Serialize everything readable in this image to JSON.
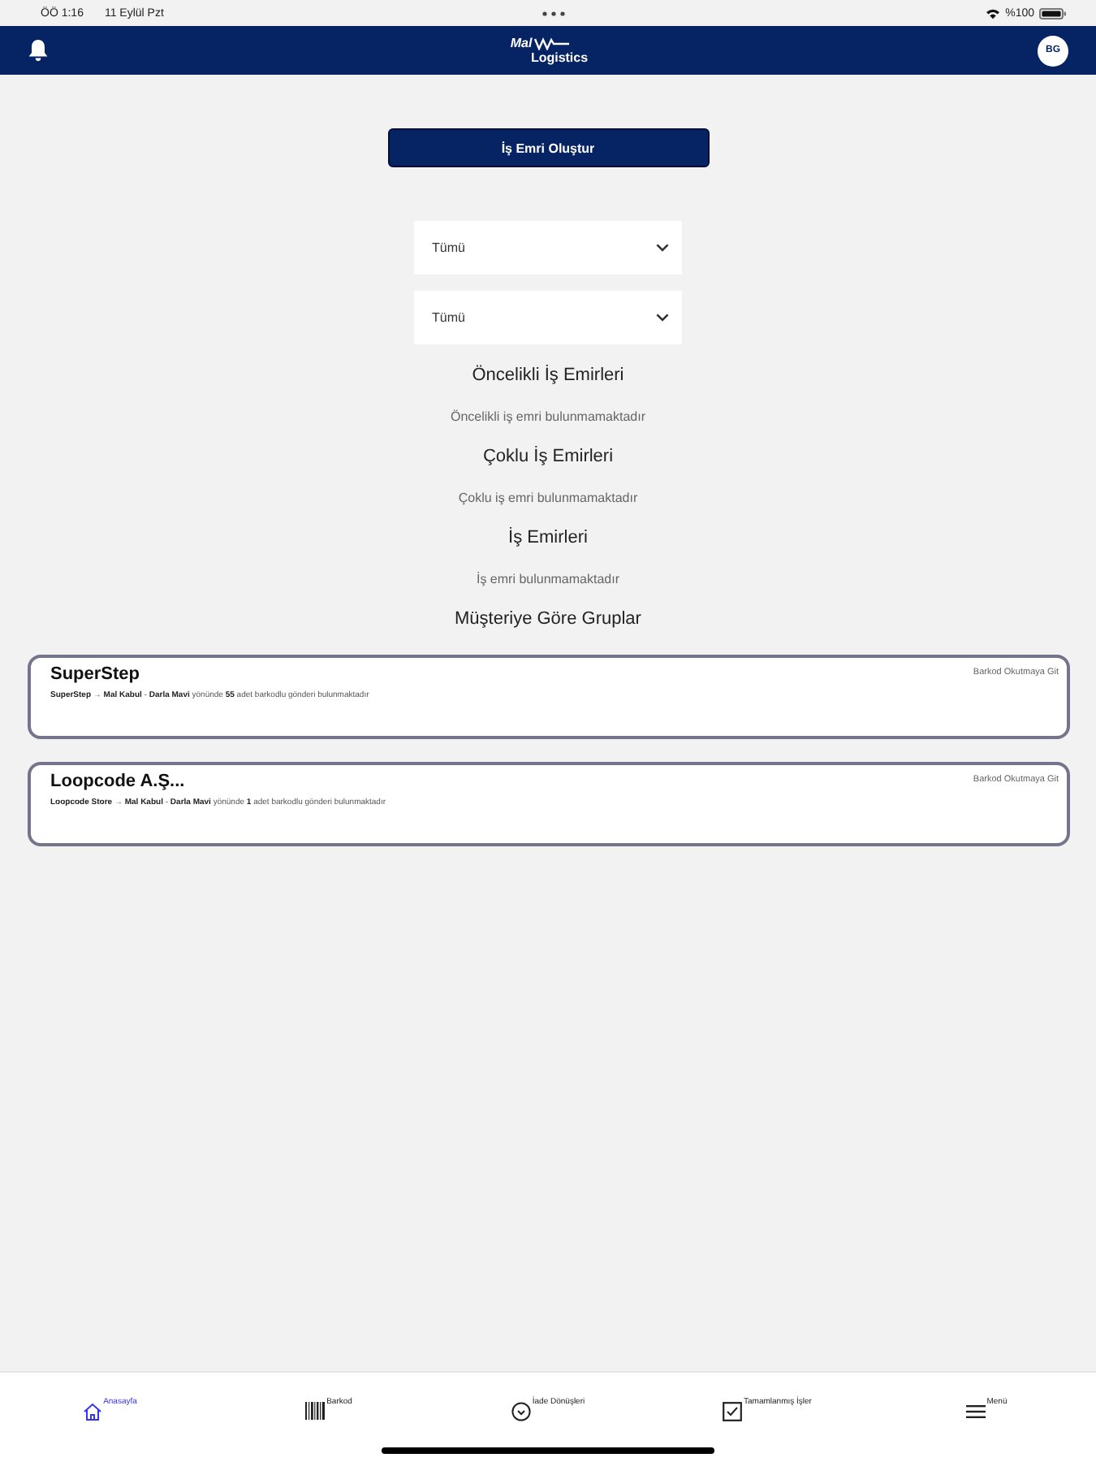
{
  "status_bar": {
    "time": "ÖÖ 1:16",
    "date": "11 Eylül Pzt",
    "battery": "%100"
  },
  "header": {
    "logo_top": "Mal",
    "logo_bottom": "Logistics",
    "avatar": "BG"
  },
  "create_button": "İş Emri Oluştur",
  "filters": [
    {
      "value": "Tümü"
    },
    {
      "value": "Tümü"
    }
  ],
  "sections": [
    {
      "title": "Öncelikli İş Emirleri",
      "empty_text": "Öncelikli iş emri bulunmamaktadır"
    },
    {
      "title": "Çoklu İş Emirleri",
      "empty_text": "Çoklu iş emri bulunmamaktadır"
    },
    {
      "title": "İş Emirleri",
      "empty_text": "İş emri bulunmamaktadır"
    }
  ],
  "groups_title": "Müşteriye Göre Gruplar",
  "customer_groups": [
    {
      "name": "SuperStep",
      "summary": "**SuperStep** → **Mal Kabul** - **Darla Mavi** yönünde **55** adet barkodlu gönderi bulunmaktadır",
      "action": "Barkod Okutmaya Git"
    },
    {
      "name": "Loopcode A.Ş...",
      "summary": "**Loopcode Store** → **Mal Kabul** - **Darla Mavi** yönünde **1** adet barkodlu gönderi bulunmaktadır",
      "action": "Barkod Okutmaya Git"
    }
  ],
  "tab_bar": [
    {
      "label": "Anasayfa",
      "kind": "home",
      "selected": true
    },
    {
      "label": "Barkod",
      "kind": "barcode",
      "selected": false
    },
    {
      "label": "İade Dönüşleri",
      "kind": "return",
      "selected": false
    },
    {
      "label": "Tamamlanmış İşler",
      "kind": "checklist",
      "selected": false
    },
    {
      "label": "Menü",
      "kind": "menu",
      "selected": false
    }
  ]
}
